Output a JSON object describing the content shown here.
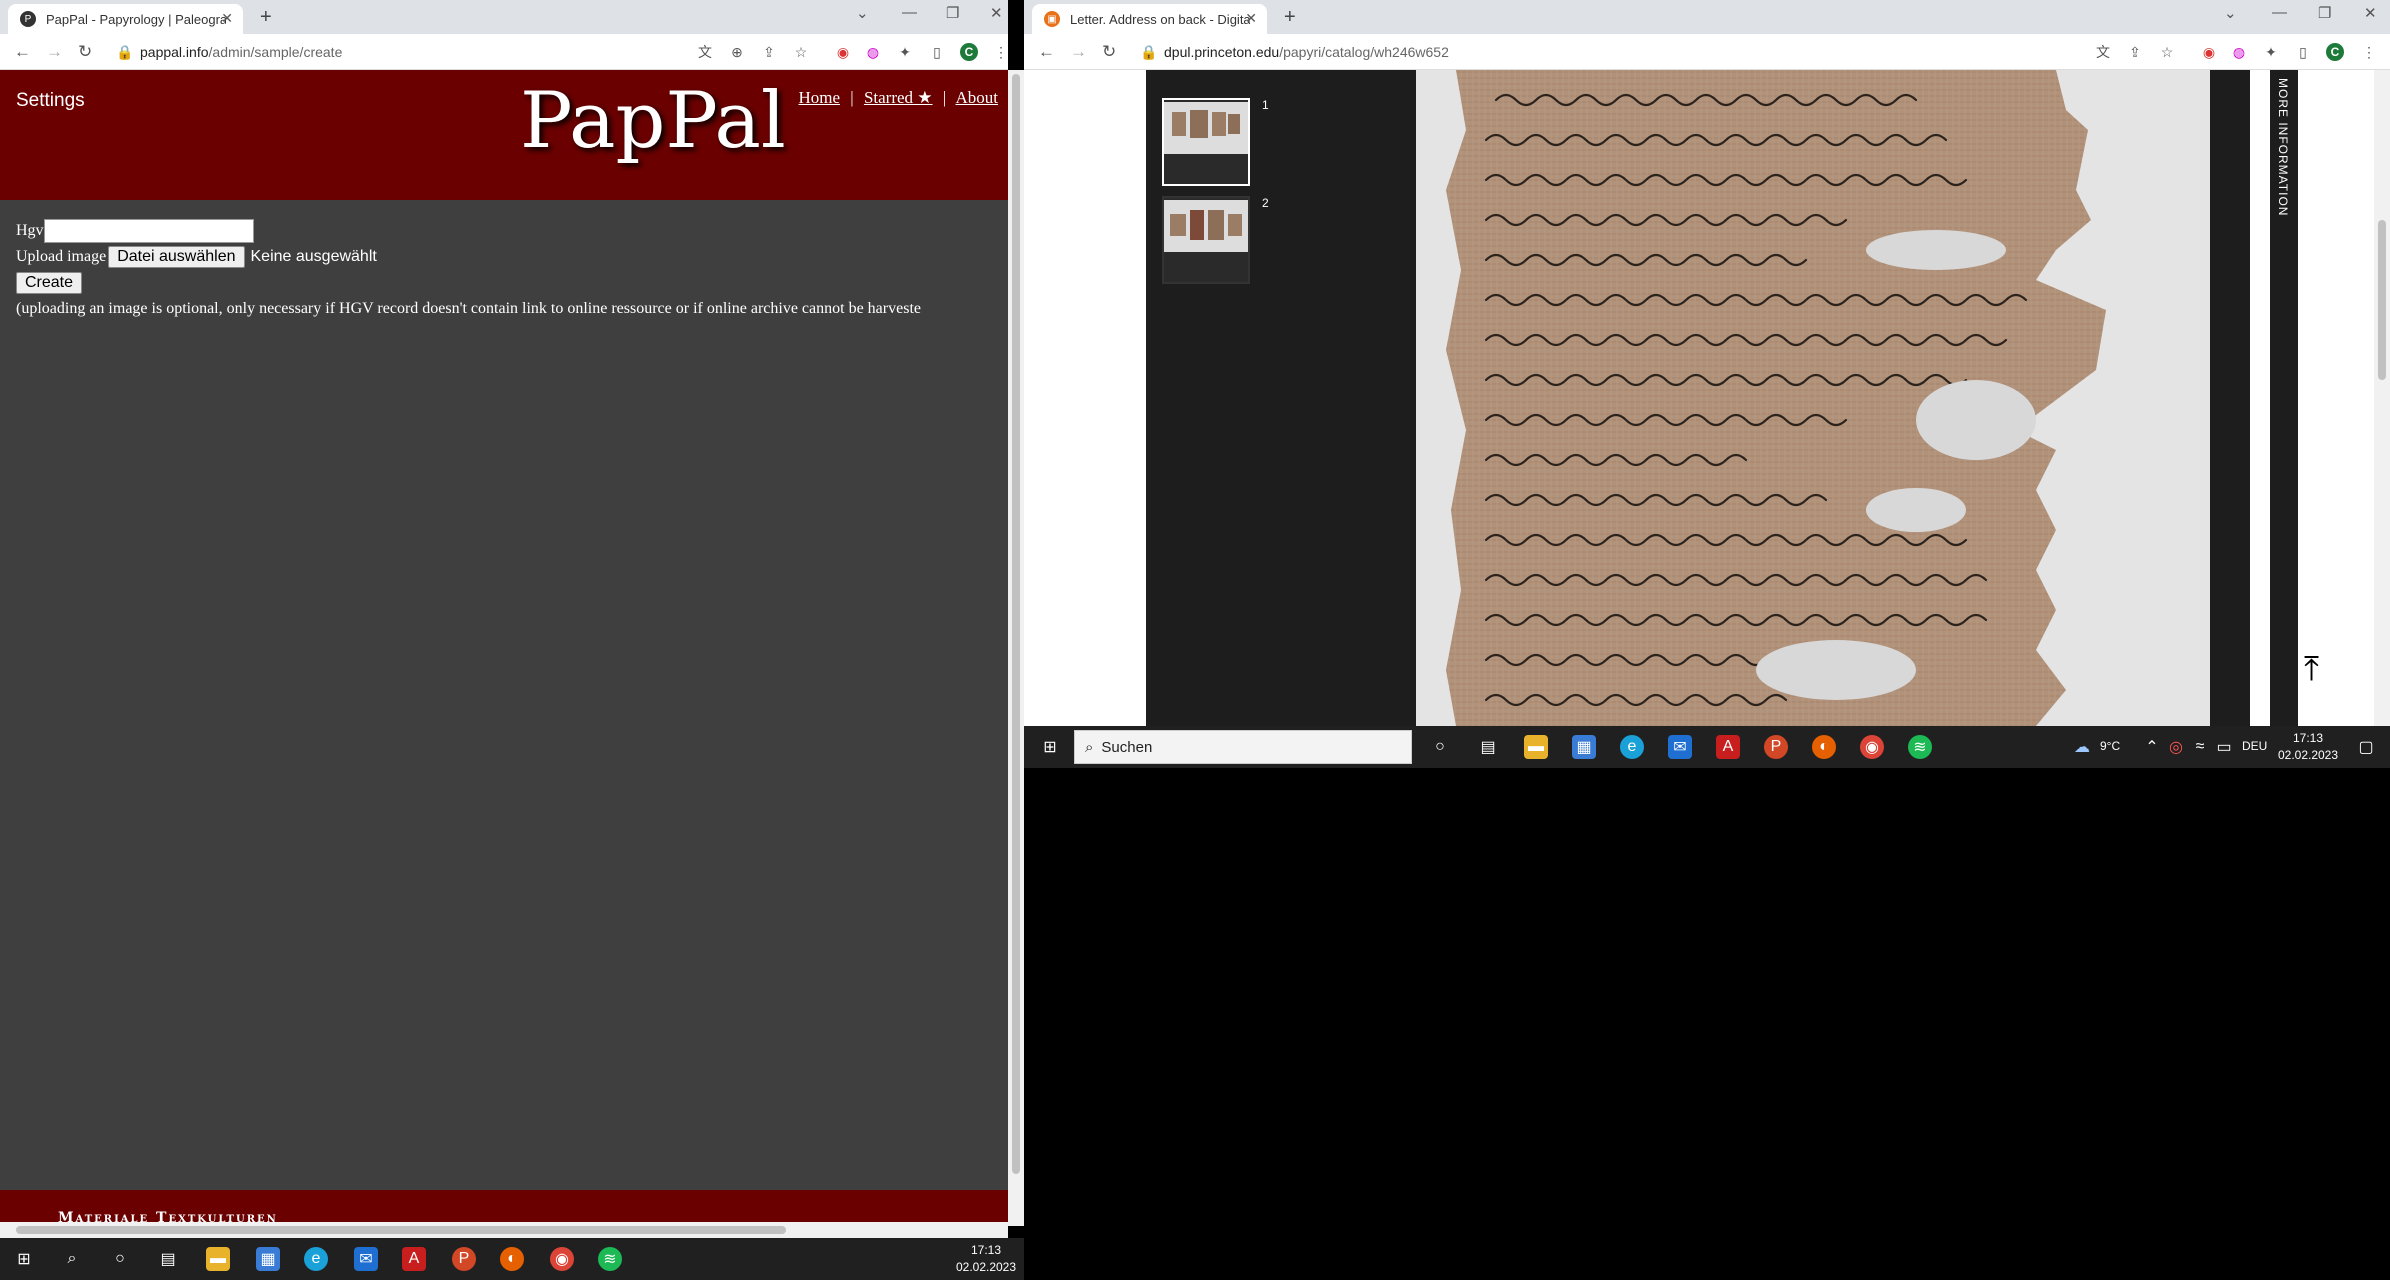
{
  "left_browser": {
    "tab_title": "PapPal - Papyrology | Paleograph",
    "url_host": "pappal.info",
    "url_path": "/admin/sample/create",
    "profile_initial": "C"
  },
  "left_page": {
    "settings_label": "Settings",
    "logo": "PapPal",
    "nav": [
      "Home",
      "Starred ★",
      "About"
    ],
    "nav_sep": "|",
    "hgv_label": "Hgv",
    "upload_label": "Upload image",
    "file_button": "Datei auswählen",
    "file_status": "Keine ausgewählt",
    "create_button": "Create",
    "note": "(uploading an image is optional, only necessary if HGV record doesn't contain link to online ressource or if online archive cannot be harveste",
    "footer": "Materiale Textkulturen"
  },
  "right_browser": {
    "tab_title": "Letter. Address on back - Digital",
    "url_host": "dpul.princeton.edu",
    "url_path": "/papyri/catalog/wh246w652",
    "profile_initial": "C"
  },
  "right_page": {
    "thumb_numbers": [
      "1",
      "2"
    ],
    "side_label": "MORE INFORMATION"
  },
  "right_taskbar": {
    "search_placeholder": "Suchen",
    "weather": "9°C",
    "lang": "DEU",
    "time": "17:13",
    "date": "02.02.2023"
  },
  "left_taskbar": {
    "time": "17:13",
    "date": "02.02.2023"
  },
  "colors": {
    "header_red": "#6b0000",
    "page_bg": "#3f3f3f"
  }
}
